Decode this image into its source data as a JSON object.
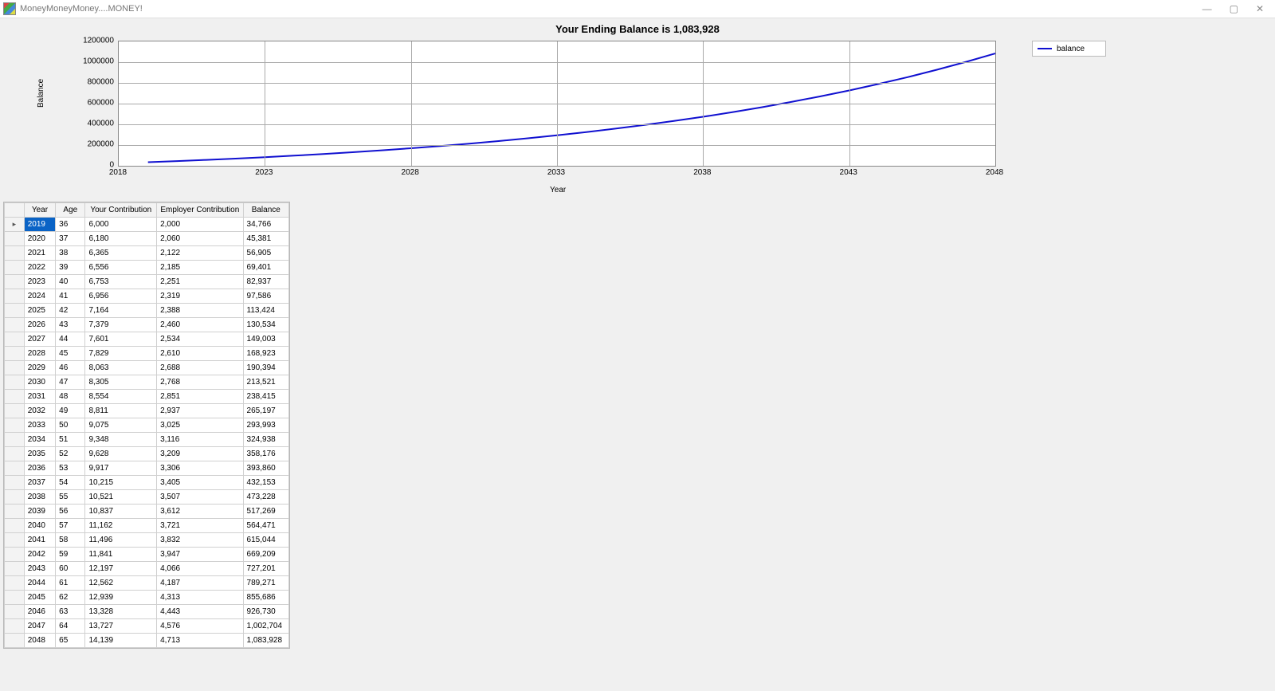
{
  "window": {
    "title": "MoneyMoneyMoney....MONEY!"
  },
  "chart_data": {
    "type": "line",
    "title": "Your Ending Balance is 1,083,928",
    "xlabel": "Year",
    "ylabel": "Balance",
    "x_ticks": [
      2018,
      2023,
      2028,
      2033,
      2038,
      2043,
      2048
    ],
    "y_ticks": [
      0,
      200000,
      400000,
      600000,
      800000,
      1000000,
      1200000
    ],
    "xlim": [
      2018,
      2048
    ],
    "ylim": [
      0,
      1200000
    ],
    "legend": [
      "balance"
    ],
    "series": [
      {
        "name": "balance",
        "color": "#1010d0",
        "x": [
          2019,
          2020,
          2021,
          2022,
          2023,
          2024,
          2025,
          2026,
          2027,
          2028,
          2029,
          2030,
          2031,
          2032,
          2033,
          2034,
          2035,
          2036,
          2037,
          2038,
          2039,
          2040,
          2041,
          2042,
          2043,
          2044,
          2045,
          2046,
          2047,
          2048
        ],
        "y": [
          34766,
          45381,
          56905,
          69401,
          82937,
          97586,
          113424,
          130534,
          149003,
          168923,
          190394,
          213521,
          238415,
          265197,
          293993,
          324938,
          358176,
          393860,
          432153,
          473228,
          517269,
          564471,
          615044,
          669209,
          727201,
          789271,
          855686,
          926730,
          1002704,
          1083928
        ]
      }
    ]
  },
  "grid": {
    "headers": [
      "Year",
      "Age",
      "Your Contribution",
      "Employer Contribution",
      "Balance"
    ],
    "selected_row": 0,
    "rows": [
      {
        "year": "2019",
        "age": "36",
        "yc": "6,000",
        "ec": "2,000",
        "bal": "34,766"
      },
      {
        "year": "2020",
        "age": "37",
        "yc": "6,180",
        "ec": "2,060",
        "bal": "45,381"
      },
      {
        "year": "2021",
        "age": "38",
        "yc": "6,365",
        "ec": "2,122",
        "bal": "56,905"
      },
      {
        "year": "2022",
        "age": "39",
        "yc": "6,556",
        "ec": "2,185",
        "bal": "69,401"
      },
      {
        "year": "2023",
        "age": "40",
        "yc": "6,753",
        "ec": "2,251",
        "bal": "82,937"
      },
      {
        "year": "2024",
        "age": "41",
        "yc": "6,956",
        "ec": "2,319",
        "bal": "97,586"
      },
      {
        "year": "2025",
        "age": "42",
        "yc": "7,164",
        "ec": "2,388",
        "bal": "113,424"
      },
      {
        "year": "2026",
        "age": "43",
        "yc": "7,379",
        "ec": "2,460",
        "bal": "130,534"
      },
      {
        "year": "2027",
        "age": "44",
        "yc": "7,601",
        "ec": "2,534",
        "bal": "149,003"
      },
      {
        "year": "2028",
        "age": "45",
        "yc": "7,829",
        "ec": "2,610",
        "bal": "168,923"
      },
      {
        "year": "2029",
        "age": "46",
        "yc": "8,063",
        "ec": "2,688",
        "bal": "190,394"
      },
      {
        "year": "2030",
        "age": "47",
        "yc": "8,305",
        "ec": "2,768",
        "bal": "213,521"
      },
      {
        "year": "2031",
        "age": "48",
        "yc": "8,554",
        "ec": "2,851",
        "bal": "238,415"
      },
      {
        "year": "2032",
        "age": "49",
        "yc": "8,811",
        "ec": "2,937",
        "bal": "265,197"
      },
      {
        "year": "2033",
        "age": "50",
        "yc": "9,075",
        "ec": "3,025",
        "bal": "293,993"
      },
      {
        "year": "2034",
        "age": "51",
        "yc": "9,348",
        "ec": "3,116",
        "bal": "324,938"
      },
      {
        "year": "2035",
        "age": "52",
        "yc": "9,628",
        "ec": "3,209",
        "bal": "358,176"
      },
      {
        "year": "2036",
        "age": "53",
        "yc": "9,917",
        "ec": "3,306",
        "bal": "393,860"
      },
      {
        "year": "2037",
        "age": "54",
        "yc": "10,215",
        "ec": "3,405",
        "bal": "432,153"
      },
      {
        "year": "2038",
        "age": "55",
        "yc": "10,521",
        "ec": "3,507",
        "bal": "473,228"
      },
      {
        "year": "2039",
        "age": "56",
        "yc": "10,837",
        "ec": "3,612",
        "bal": "517,269"
      },
      {
        "year": "2040",
        "age": "57",
        "yc": "11,162",
        "ec": "3,721",
        "bal": "564,471"
      },
      {
        "year": "2041",
        "age": "58",
        "yc": "11,496",
        "ec": "3,832",
        "bal": "615,044"
      },
      {
        "year": "2042",
        "age": "59",
        "yc": "11,841",
        "ec": "3,947",
        "bal": "669,209"
      },
      {
        "year": "2043",
        "age": "60",
        "yc": "12,197",
        "ec": "4,066",
        "bal": "727,201"
      },
      {
        "year": "2044",
        "age": "61",
        "yc": "12,562",
        "ec": "4,187",
        "bal": "789,271"
      },
      {
        "year": "2045",
        "age": "62",
        "yc": "12,939",
        "ec": "4,313",
        "bal": "855,686"
      },
      {
        "year": "2046",
        "age": "63",
        "yc": "13,328",
        "ec": "4,443",
        "bal": "926,730"
      },
      {
        "year": "2047",
        "age": "64",
        "yc": "13,727",
        "ec": "4,576",
        "bal": "1,002,704"
      },
      {
        "year": "2048",
        "age": "65",
        "yc": "14,139",
        "ec": "4,713",
        "bal": "1,083,928"
      }
    ]
  }
}
